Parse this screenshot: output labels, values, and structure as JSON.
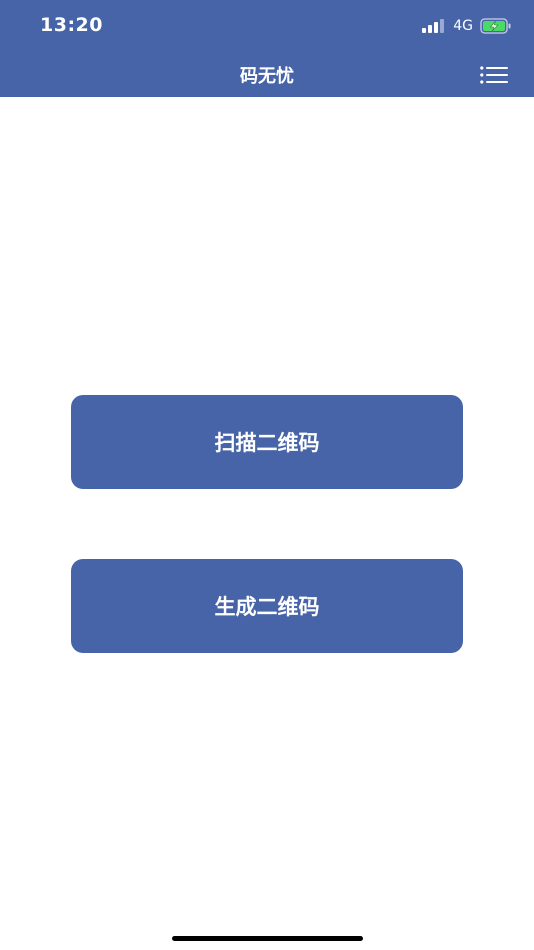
{
  "status_bar": {
    "time": "13:20",
    "network": "4G",
    "icons": [
      "signal-icon",
      "battery-charging-icon"
    ]
  },
  "nav": {
    "title": "码无忧",
    "menu_icon": "list-menu-icon"
  },
  "actions": {
    "scan_label": "扫描二维码",
    "generate_label": "生成二维码"
  },
  "colors": {
    "primary": "#4764a8",
    "background": "#ffffff",
    "battery_fill": "#4cd964"
  }
}
